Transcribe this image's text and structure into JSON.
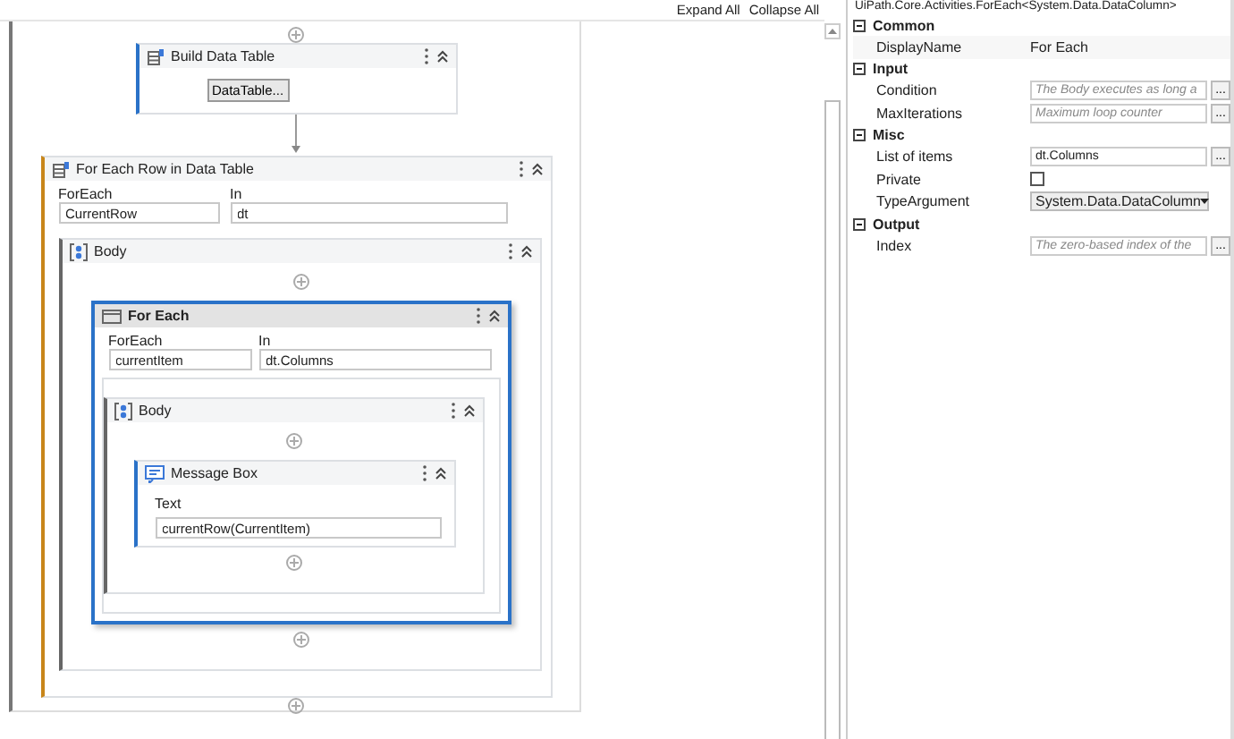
{
  "toolbar": {
    "expand_all": "Expand All",
    "collapse_all": "Collapse All"
  },
  "workflow": {
    "activities": [
      {
        "kind": "build_table",
        "title": "Build Data Table",
        "button": "DataTable..."
      },
      {
        "kind": "for_each",
        "title": "For Each Row in Data Table",
        "selected": false,
        "fields": [
          {
            "label": "ForEach",
            "value": "CurrentRow"
          },
          {
            "label": "In",
            "value": "dt"
          }
        ],
        "body": {
          "title": "Body",
          "activities": [
            {
              "kind": "for_each",
              "title": "For Each",
              "selected": true,
              "fields": [
                {
                  "label": "ForEach",
                  "value": "currentItem"
                },
                {
                  "label": "In",
                  "value": "dt.Columns"
                }
              ],
              "body": {
                "title": "Body",
                "activities": [
                  {
                    "kind": "message_box",
                    "title": "Message Box",
                    "label": "Text",
                    "value": "currentRow(CurrentItem)"
                  }
                ]
              }
            }
          ]
        }
      }
    ]
  },
  "properties": {
    "type_name": "UiPath.Core.Activities.ForEach<System.Data.DataColumn>",
    "categories": [
      {
        "name": "Common",
        "expanded": true,
        "rows": [
          {
            "kind": "text",
            "name": "DisplayName",
            "value": "For Each"
          }
        ]
      },
      {
        "name": "Input",
        "expanded": true,
        "rows": [
          {
            "kind": "expression",
            "name": "Condition",
            "placeholder": "The Body executes as long a",
            "button": "..."
          },
          {
            "kind": "expression",
            "name": "MaxIterations",
            "placeholder": "Maximum loop counter",
            "button": "..."
          }
        ]
      },
      {
        "name": "Misc",
        "expanded": true,
        "rows": [
          {
            "kind": "expression",
            "name": "List of items",
            "value": "dt.Columns",
            "button": "..."
          },
          {
            "kind": "checkbox",
            "name": "Private",
            "checked": false
          },
          {
            "kind": "dropdown",
            "name": "TypeArgument",
            "value": "System.Data.DataColumn"
          }
        ]
      },
      {
        "name": "Output",
        "expanded": true,
        "rows": [
          {
            "kind": "expression",
            "name": "Index",
            "placeholder": "The zero-based index of the",
            "button": "..."
          }
        ]
      }
    ]
  }
}
